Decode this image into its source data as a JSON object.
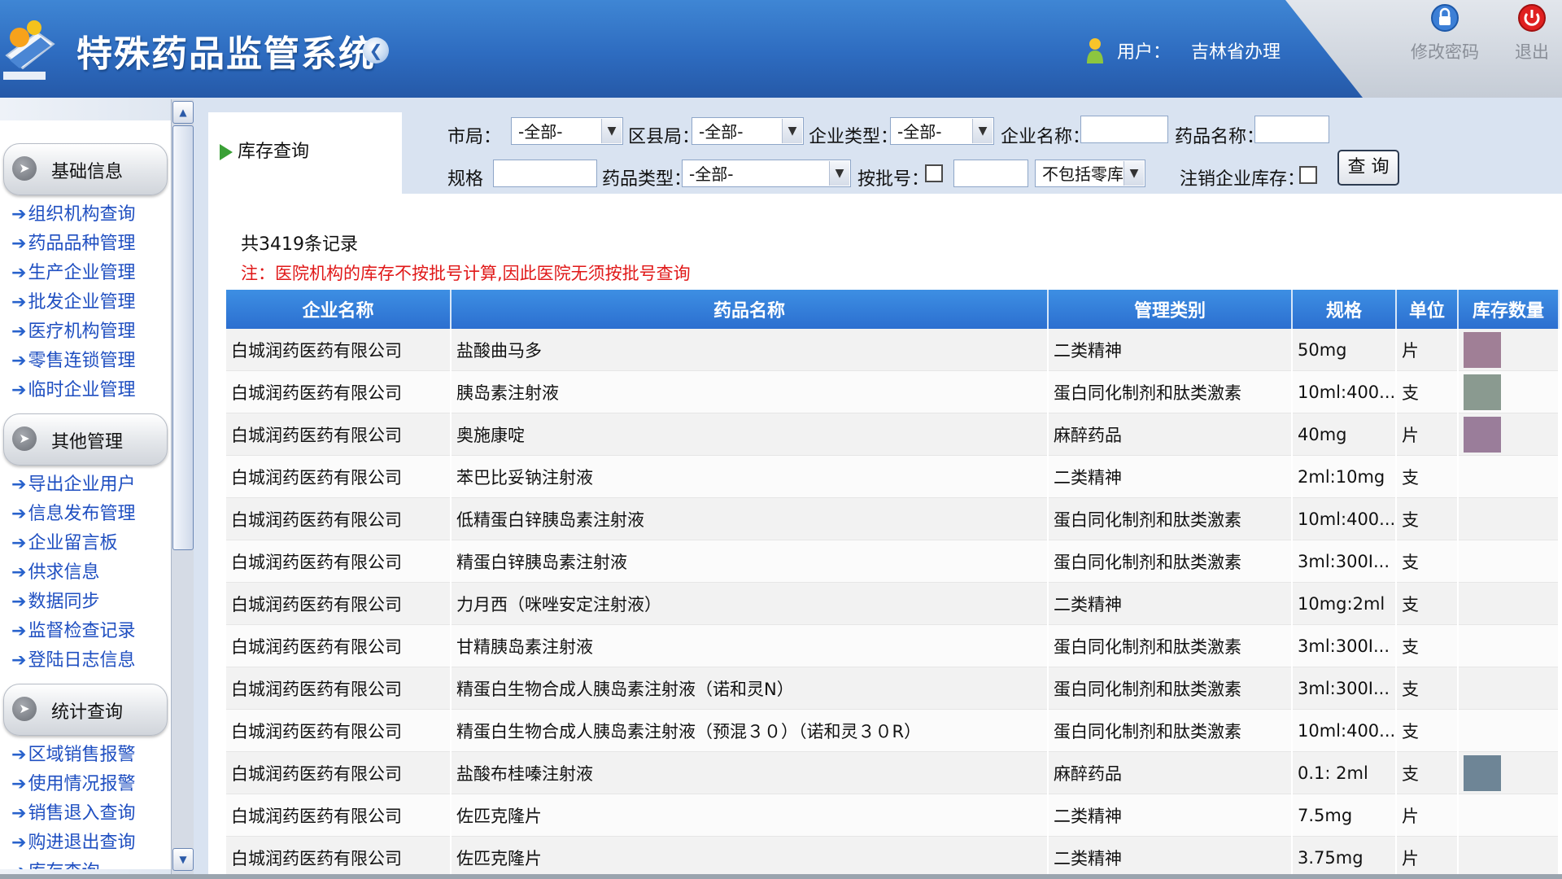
{
  "header": {
    "system_title": "特殊药品监管系统",
    "user_label": "用户：",
    "user_name": "吉林省办理",
    "change_password": "修改密码",
    "logout": "退出"
  },
  "sidebar": {
    "sections": [
      {
        "title": "基础信息",
        "items": [
          "组织机构查询",
          "药品品种管理",
          "生产企业管理",
          "批发企业管理",
          "医疗机构管理",
          "零售连锁管理",
          "临时企业管理"
        ]
      },
      {
        "title": "其他管理",
        "items": [
          "导出企业用户",
          "信息发布管理",
          "企业留言板",
          "供求信息",
          "数据同步",
          "监督检查记录",
          "登陆日志信息"
        ]
      },
      {
        "title": "统计查询",
        "items": [
          "区域销售报警",
          "使用情况报警",
          "销售退入查询",
          "购进退出查询",
          "库存查询"
        ]
      }
    ]
  },
  "tab": {
    "title": "库存查询"
  },
  "filters": {
    "city_label": "市局：",
    "city_value": "-全部-",
    "district_label": "区县局：",
    "district_value": "-全部-",
    "enterprise_type_label": "企业类型：",
    "enterprise_type_value": "-全部-",
    "enterprise_name_label": "企业名称：",
    "enterprise_name_value": "",
    "drug_name_label": "药品名称：",
    "drug_name_value": "",
    "spec_label": "规格",
    "spec_value": "",
    "drug_type_label": "药品类型：",
    "drug_type_value": "-全部-",
    "batch_label": "按批号：",
    "batch_value": "",
    "zero_stock_value": "不包括零库存",
    "cancelled_label": "注销企业库存：",
    "query_button": "查 询"
  },
  "summary": {
    "record_count": "共3419条记录",
    "note": "注：医院机构的库存不按批号计算,因此医院无须按批号查询"
  },
  "table": {
    "headers": [
      "企业名称",
      "药品名称",
      "管理类别",
      "规格",
      "单位",
      "库存数量"
    ],
    "rows": [
      [
        "白城润药医药有限公司",
        "盐酸曲马多",
        "二类精神",
        "50mg",
        "片",
        ""
      ],
      [
        "白城润药医药有限公司",
        "胰岛素注射液",
        "蛋白同化制剂和肽类激素",
        "10ml:400...",
        "支",
        ""
      ],
      [
        "白城润药医药有限公司",
        "奥施康啶",
        "麻醉药品",
        "40mg",
        "片",
        ""
      ],
      [
        "白城润药医药有限公司",
        "苯巴比妥钠注射液",
        "二类精神",
        "2ml:10mg",
        "支",
        ""
      ],
      [
        "白城润药医药有限公司",
        "低精蛋白锌胰岛素注射液",
        "蛋白同化制剂和肽类激素",
        "10ml:400...",
        "支",
        ""
      ],
      [
        "白城润药医药有限公司",
        "精蛋白锌胰岛素注射液",
        "蛋白同化制剂和肽类激素",
        "3ml:300I...",
        "支",
        ""
      ],
      [
        "白城润药医药有限公司",
        "力月西（咪唑安定注射液）",
        "二类精神",
        "10mg:2ml",
        "支",
        ""
      ],
      [
        "白城润药医药有限公司",
        "甘精胰岛素注射液",
        "蛋白同化制剂和肽类激素",
        "3ml:300I...",
        "支",
        ""
      ],
      [
        "白城润药医药有限公司",
        "精蛋白生物合成人胰岛素注射液（诺和灵N）",
        "蛋白同化制剂和肽类激素",
        "3ml:300I...",
        "支",
        ""
      ],
      [
        "白城润药医药有限公司",
        "精蛋白生物合成人胰岛素注射液（预混３０）（诺和灵３０R）",
        "蛋白同化制剂和肽类激素",
        "10ml:400...",
        "支",
        ""
      ],
      [
        "白城润药医药有限公司",
        "盐酸布桂嗪注射液",
        "麻醉药品",
        "0.1: 2ml",
        "支",
        ""
      ],
      [
        "白城润药医药有限公司",
        "佐匹克隆片",
        "二类精神",
        "7.5mg",
        "片",
        ""
      ],
      [
        "白城润药医药有限公司",
        "佐匹克隆片",
        "二类精神",
        "3.75mg",
        "片",
        ""
      ]
    ],
    "redacted_qty_colors": [
      "#a07f96",
      "#8a9a90",
      "#9a7d9a",
      "",
      "",
      "",
      "",
      "",
      "",
      "",
      "#6e8596",
      "",
      ""
    ]
  },
  "colors": {
    "header_blue": "#2e6cc0",
    "table_header_blue": "#3d8fe3",
    "sidebar_link": "#1f4fc1",
    "note_red": "#e01818"
  }
}
